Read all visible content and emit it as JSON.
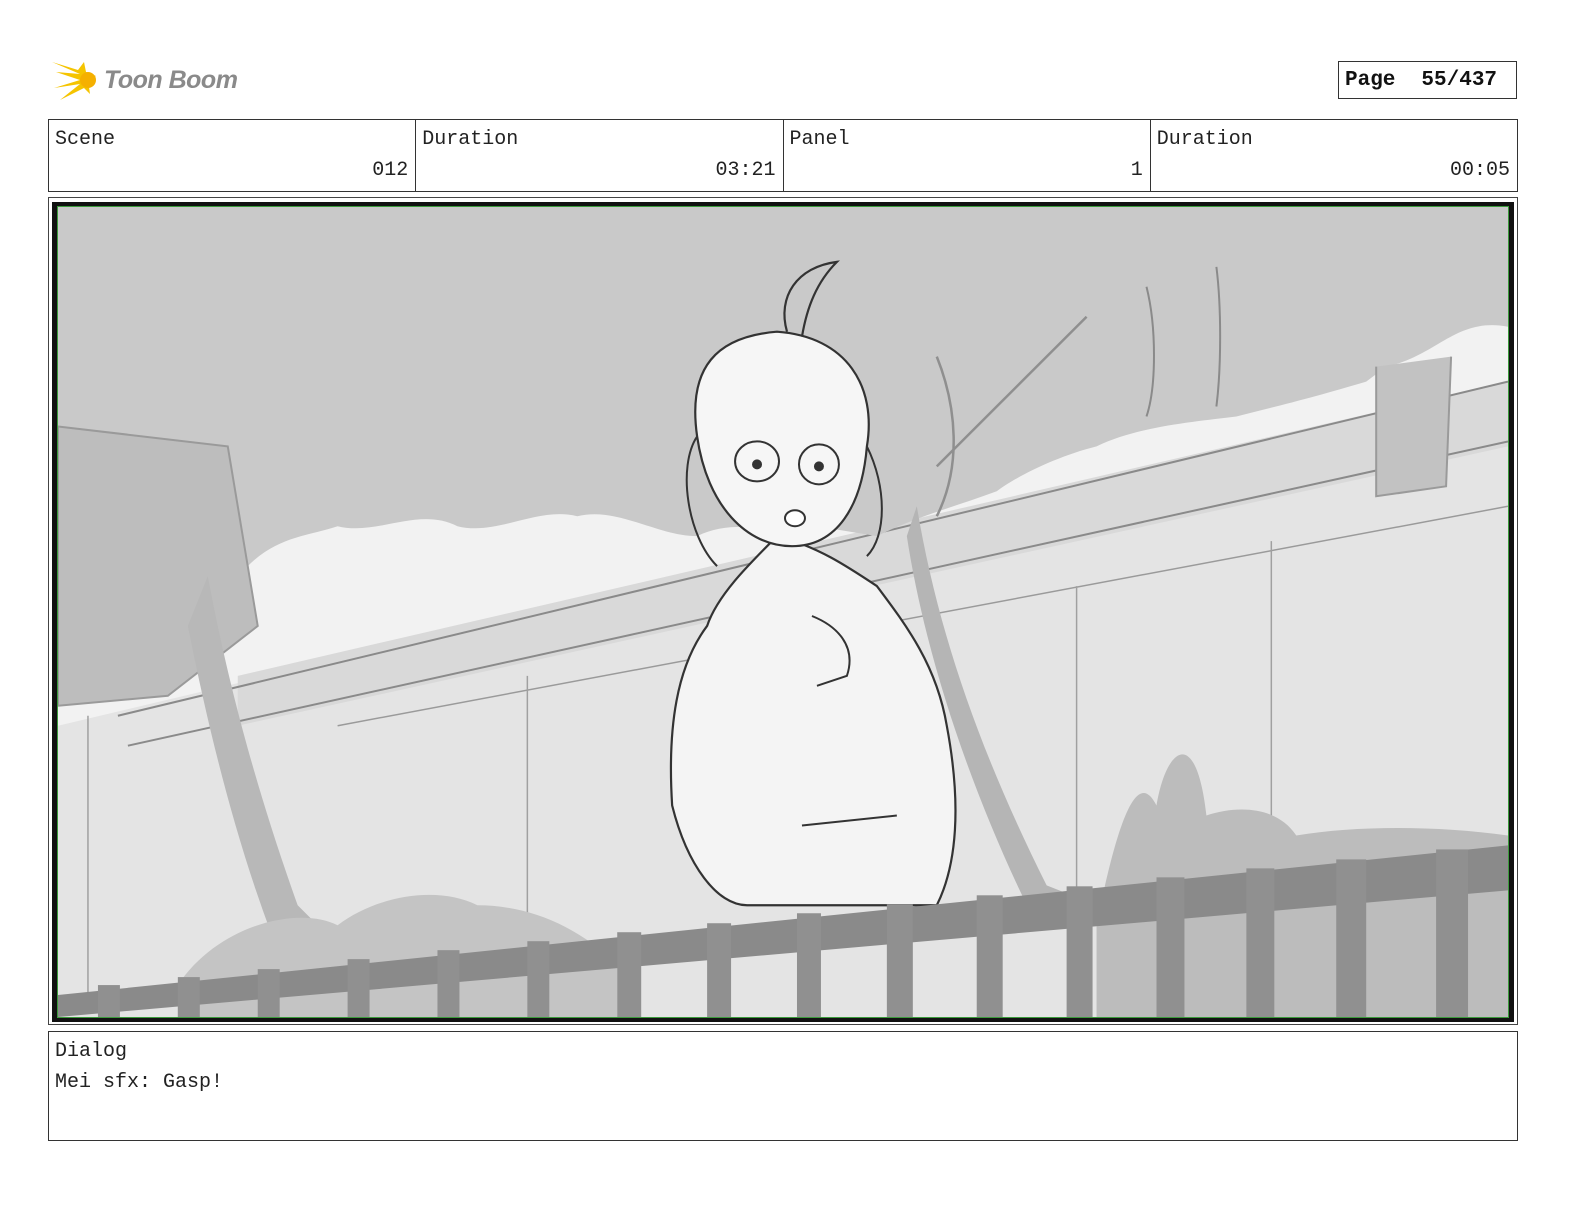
{
  "header": {
    "logo_text": "Toon Boom",
    "page_label": "Page",
    "page_number": "55/437"
  },
  "info": {
    "scene_label": "Scene",
    "scene_value": "012",
    "scene_duration_label": "Duration",
    "scene_duration_value": "03:21",
    "panel_label": "Panel",
    "panel_value": "1",
    "panel_duration_label": "Duration",
    "panel_duration_value": "00:05"
  },
  "dialog": {
    "label": "Dialog",
    "text": "Mei sfx: Gasp!"
  },
  "colors": {
    "logo_yellow": "#f5c400",
    "frame_border": "#3a9a3a",
    "sketch_line": "#333333"
  }
}
